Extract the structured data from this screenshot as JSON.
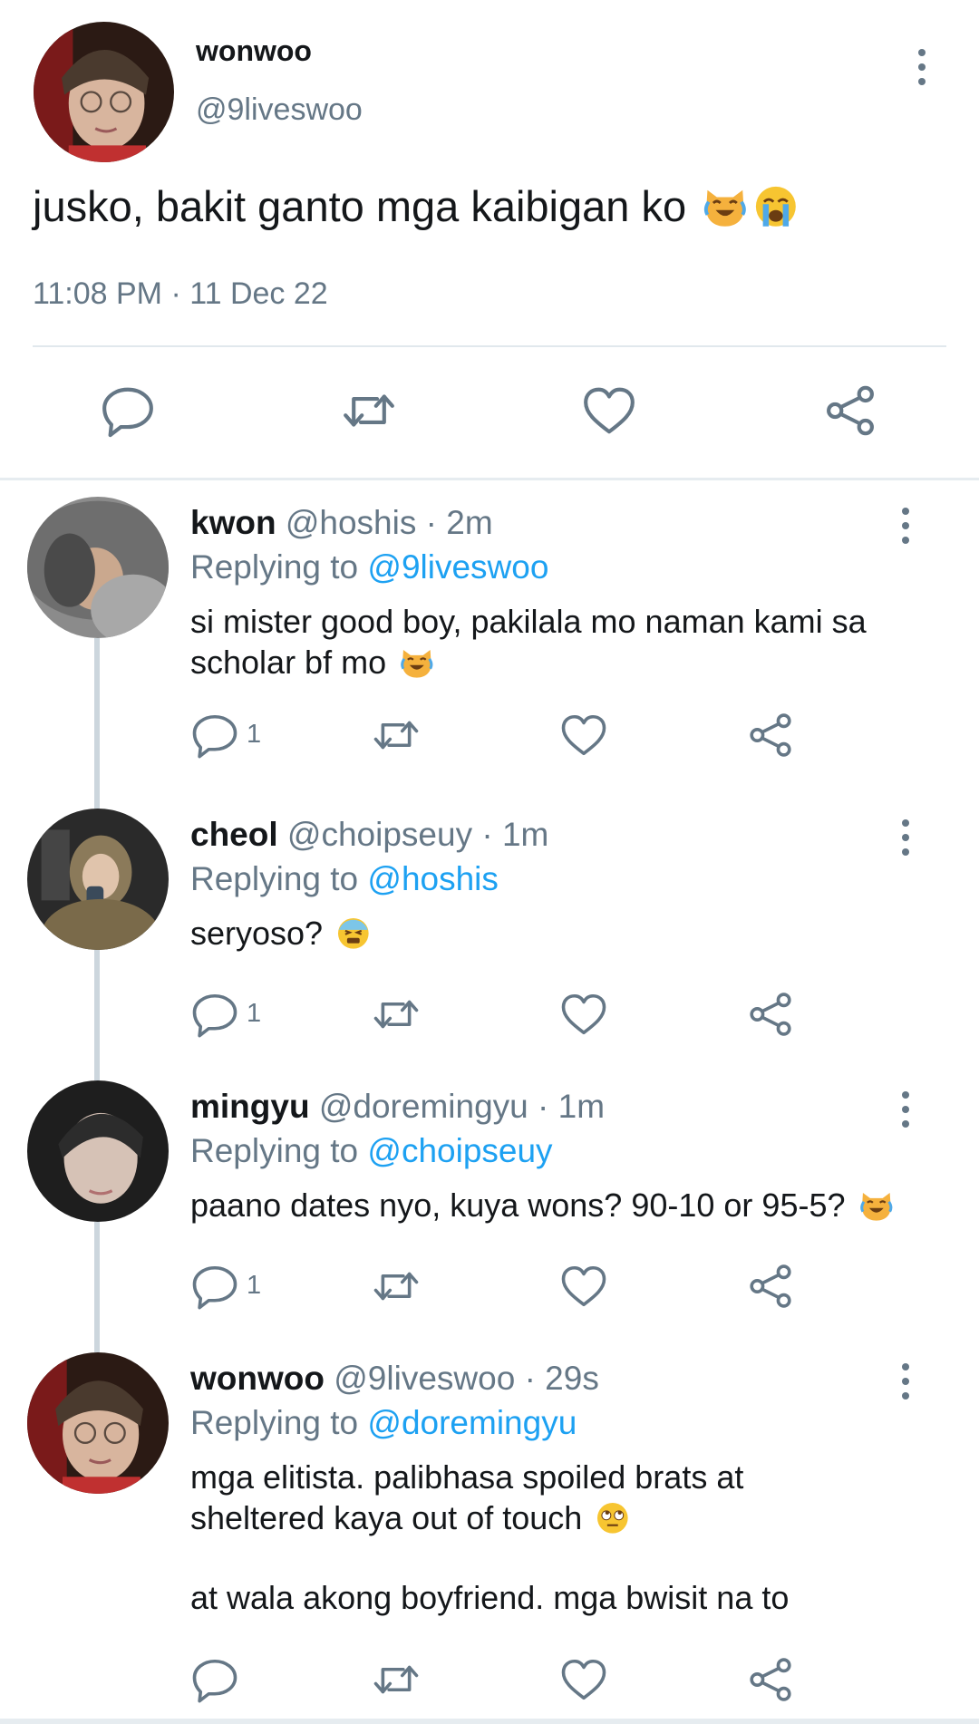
{
  "main_tweet": {
    "name": "wonwoo",
    "handle": "@9liveswoo",
    "text": "jusko, bakit ganto mga kaibigan ko",
    "emojis": [
      "cat-tears-of-joy-emoji",
      "loudly-crying-face-emoji"
    ],
    "timestamp": "11:08 PM · 11 Dec 22",
    "actions": [
      "reply-icon",
      "retweet-icon",
      "like-icon",
      "share-icon"
    ]
  },
  "replies": [
    {
      "name": "kwon",
      "handle": "@hoshis",
      "time": "· 2m",
      "replying_label": "Replying to",
      "replying_to": "@9liveswoo",
      "text_lines": [
        "si mister good boy, pakilala mo naman kami sa",
        "scholar bf mo"
      ],
      "emoji": "cat-tears-of-joy-emoji",
      "reply_count": "1"
    },
    {
      "name": "cheol",
      "handle": "@choipseuy",
      "time": "· 1m",
      "replying_label": "Replying to",
      "replying_to": "@hoshis",
      "text_lines": [
        "seryoso?"
      ],
      "emoji": "anxious-face-emoji",
      "reply_count": "1"
    },
    {
      "name": "mingyu",
      "handle": "@doremingyu",
      "time": "· 1m",
      "replying_label": "Replying to",
      "replying_to": "@choipseuy",
      "text_lines": [
        "paano dates nyo, kuya wons? 90-10 or 95-5?"
      ],
      "emoji": "cat-tears-of-joy-emoji",
      "reply_count": "1"
    },
    {
      "name": "wonwoo",
      "handle": "@9liveswoo",
      "time": "· 29s",
      "replying_label": "Replying to",
      "replying_to": "@doremingyu",
      "text_lines": [
        "mga elitista. palibhasa spoiled brats at",
        "sheltered kaya out of touch"
      ],
      "emoji": "face-with-rolling-eyes-emoji",
      "text_extra": "at wala akong boyfriend. mga bwisit na to",
      "reply_count": ""
    }
  ],
  "colors": {
    "text": "#14171a",
    "secondary": "#657786",
    "link": "#1da1f2",
    "divider": "#e1e8ed",
    "thread_line": "#ccd6dd"
  }
}
